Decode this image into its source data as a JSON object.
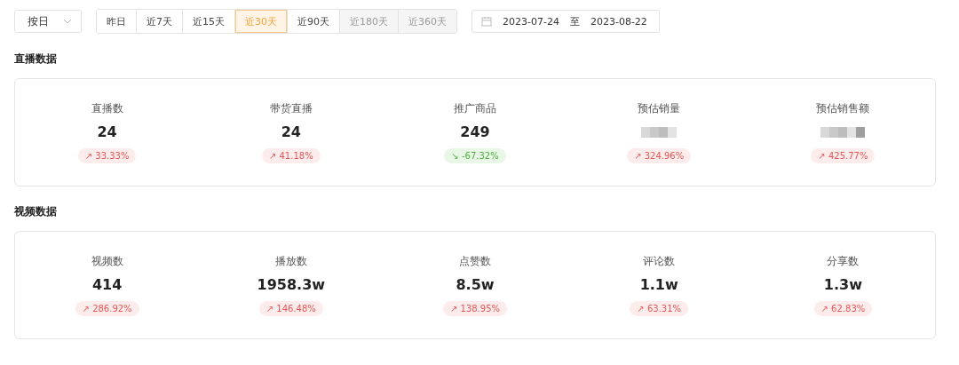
{
  "granularity": {
    "value": "按日"
  },
  "ranges": [
    {
      "label": "昨日",
      "selected": false,
      "disabled": false
    },
    {
      "label": "近7天",
      "selected": false,
      "disabled": false
    },
    {
      "label": "近15天",
      "selected": false,
      "disabled": false
    },
    {
      "label": "近30天",
      "selected": true,
      "disabled": false
    },
    {
      "label": "近90天",
      "selected": false,
      "disabled": false
    },
    {
      "label": "近180天",
      "selected": false,
      "disabled": true
    },
    {
      "label": "近360天",
      "selected": false,
      "disabled": true
    }
  ],
  "date_range": {
    "start": "2023-07-24",
    "separator": "至",
    "end": "2023-08-22"
  },
  "sections": [
    {
      "title": "直播数据",
      "metrics": [
        {
          "label": "直播数",
          "kind": "number",
          "value": "24",
          "arrow": "↗",
          "change": "33.33%",
          "rising": true
        },
        {
          "label": "带货直播",
          "kind": "number",
          "value": "24",
          "arrow": "↗",
          "change": "41.18%",
          "rising": true
        },
        {
          "label": "推广商品",
          "kind": "number",
          "value": "249",
          "arrow": "↘",
          "change": "-67.32%",
          "rising": false
        },
        {
          "label": "预估销量",
          "kind": "masked",
          "arrow": "↗",
          "change": "324.96%",
          "rising": true
        },
        {
          "label": "预估销售额",
          "kind": "masked",
          "arrow": "↗",
          "change": "425.77%",
          "rising": true
        }
      ]
    },
    {
      "title": "视频数据",
      "metrics": [
        {
          "label": "视频数",
          "kind": "number",
          "value": "414",
          "arrow": "↗",
          "change": "286.92%",
          "rising": true
        },
        {
          "label": "播放数",
          "kind": "number",
          "value": "1958.3w",
          "arrow": "↗",
          "change": "146.48%",
          "rising": true
        },
        {
          "label": "点赞数",
          "kind": "number",
          "value": "8.5w",
          "arrow": "↗",
          "change": "138.95%",
          "rising": true
        },
        {
          "label": "评论数",
          "kind": "number",
          "value": "1.1w",
          "arrow": "↗",
          "change": "63.31%",
          "rising": true
        },
        {
          "label": "分享数",
          "kind": "number",
          "value": "1.3w",
          "arrow": "↗",
          "change": "62.83%",
          "rising": true
        }
      ]
    }
  ]
}
